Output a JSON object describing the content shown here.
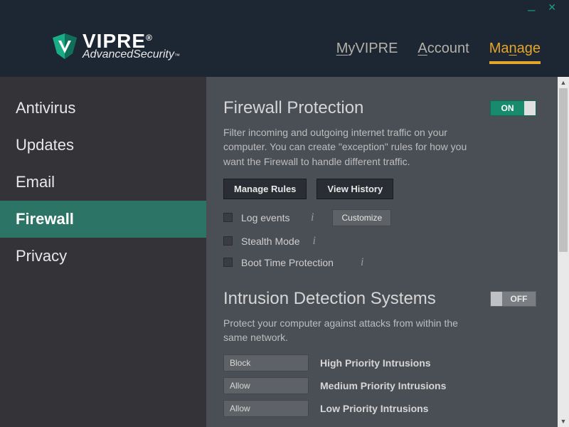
{
  "brand": {
    "name": "VIPRE",
    "tagline": "AdvancedSecurity"
  },
  "nav": {
    "myvipre": "MyVIPRE",
    "account": "Account",
    "manage": "Manage"
  },
  "sidebar": {
    "items": [
      {
        "label": "Antivirus"
      },
      {
        "label": "Updates"
      },
      {
        "label": "Email"
      },
      {
        "label": "Firewall"
      },
      {
        "label": "Privacy"
      }
    ]
  },
  "firewall": {
    "title": "Firewall Protection",
    "toggle": "ON",
    "desc": "Filter incoming and outgoing internet traffic on your computer. You can create \"exception\" rules for how you want the Firewall to handle different traffic.",
    "manage_rules": "Manage Rules",
    "view_history": "View History",
    "log_events": "Log events",
    "customize": "Customize",
    "stealth_mode": "Stealth Mode",
    "boot_time": "Boot Time Protection"
  },
  "ids": {
    "title": "Intrusion Detection Systems",
    "toggle": "OFF",
    "desc": "Protect your computer against attacks from within the same network.",
    "rows": [
      {
        "action": "Block",
        "label": "High Priority Intrusions"
      },
      {
        "action": "Allow",
        "label": "Medium Priority Intrusions"
      },
      {
        "action": "Allow",
        "label": "Low Priority Intrusions"
      }
    ]
  }
}
